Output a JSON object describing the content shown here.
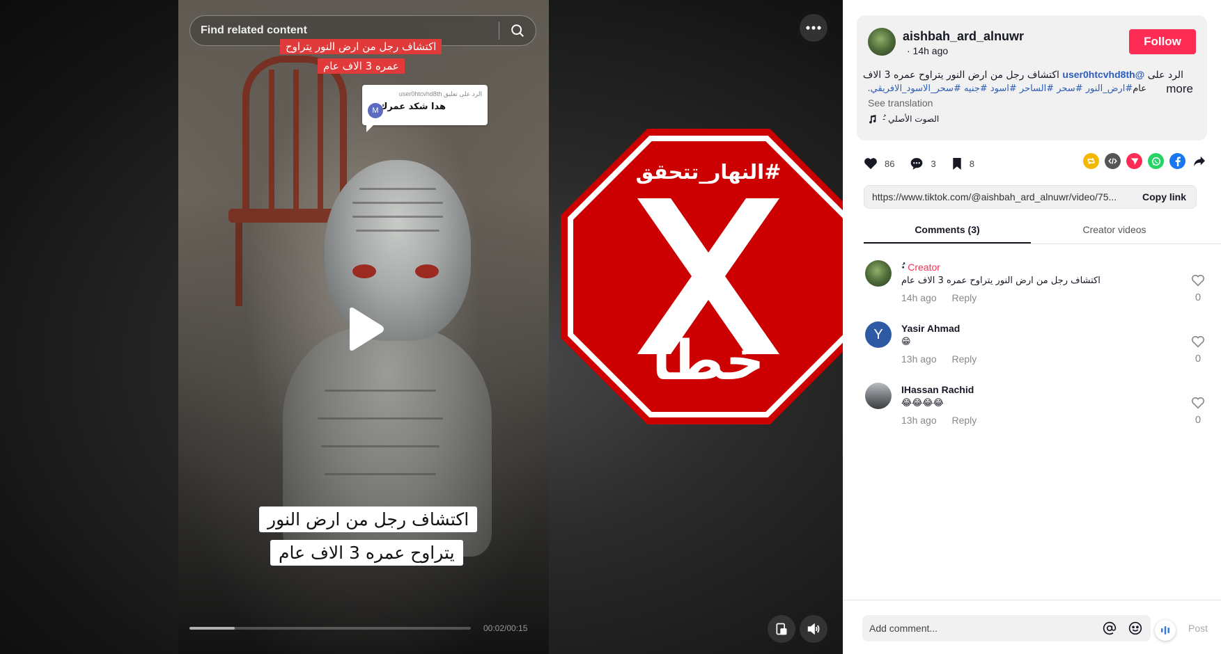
{
  "player": {
    "search_placeholder": "Find related content",
    "top_caption_line1": "اكتشاف رجل من ارض النور يتراوح",
    "top_caption_line2": "عمره 3 الاف عام",
    "reply_card_small": "الرد على تعليق user0htcvhd8th",
    "reply_card_text": "هدا شكد عمرك",
    "reply_card_avatar_letter": "M",
    "bottom_caption_line1": "اكتشاف رجل من ارض النور",
    "bottom_caption_line2": "يتراوح عمره 3 الاف عام",
    "time": "00:02/00:15",
    "progress_fraction": 0.16
  },
  "stop_sign": {
    "hashtag": "#النهار_تتحقق",
    "mark": "X",
    "verdict": "خطأ",
    "color": "#cc0000"
  },
  "post": {
    "author": "aishbah_ard_alnuwr",
    "time": "· 14h ago",
    "follow_label": "Follow",
    "desc_prefix": "الرد على",
    "desc_mention": "@user0htcvhd8th",
    "desc_rest": "اكتشاف رجل من ارض النور يتراوح عمره 3 الاف",
    "desc_line2_word": "عام",
    "desc_line2_tags": "#ارض_النور #سحر #الساحر #اسود #جنيه #سحر_الاسود_الافريقي...",
    "more_label": "more",
    "see_translation": "See translation",
    "music": "الصوت الأصلي -ُ"
  },
  "actions": {
    "likes": "86",
    "comments": "3",
    "saves": "8"
  },
  "share_colors": {
    "repost": "#f5b800",
    "embed": "#555555",
    "tiktok": "#fe2c55",
    "whatsapp": "#25d366",
    "facebook": "#1877f2"
  },
  "link": {
    "url": "https://www.tiktok.com/@aishbah_ard_alnuwr/video/75...",
    "copy_label": "Copy link"
  },
  "tabs": {
    "comments": "Comments (3)",
    "creator_videos": "Creator videos"
  },
  "comments": [
    {
      "name": "·ُ",
      "badge": "Creator",
      "text": "اكتشاف رجل من ارض النور يتراوح عمره 3 الاف عام",
      "time": "14h ago",
      "reply": "Reply",
      "likes": "0",
      "avatar_letter": "",
      "avatar_color": "#4f6b38"
    },
    {
      "name": "Yasir Ahmad",
      "badge": "",
      "text": "😁",
      "time": "13h ago",
      "reply": "Reply",
      "likes": "0",
      "avatar_letter": "Y",
      "avatar_color": "#2d5aa3"
    },
    {
      "name": "IHassan Rachid",
      "badge": "",
      "text": "😂😂😂😂",
      "time": "13h ago",
      "reply": "Reply",
      "likes": "0",
      "avatar_letter": "",
      "avatar_color": "#6f7478"
    }
  ],
  "footer": {
    "comment_placeholder": "Add comment...",
    "post_label": "Post"
  }
}
